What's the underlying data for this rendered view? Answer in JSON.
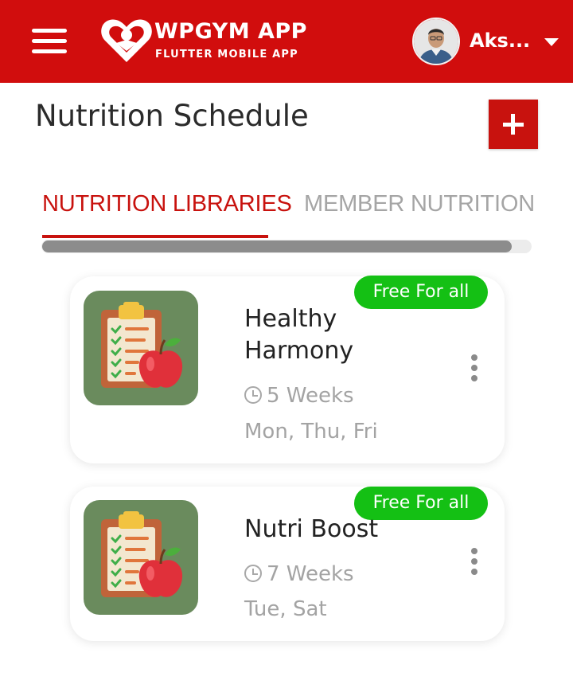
{
  "header": {
    "brand_title": "WPGYM APP",
    "brand_subtitle": "FLUTTER MOBILE APP",
    "user_name": "Aks...",
    "icons": {
      "menu": "hamburger-menu-icon",
      "logo": "heart-logo-icon",
      "dropdown": "caret-down-icon"
    },
    "colors": {
      "background": "#d10d0d",
      "text": "#ffffff"
    }
  },
  "page": {
    "title": "Nutrition Schedule",
    "add_icon": "plus-icon",
    "accent": "#c8120e"
  },
  "tabs": [
    {
      "label": "NUTRITION LIBRARIES",
      "active": true
    },
    {
      "label": "MEMBER NUTRITION",
      "active": false
    }
  ],
  "cards": [
    {
      "title": "Healthy Harmony",
      "badge": "Free For all",
      "duration": "5 Weeks",
      "days": "Mon, Thu, Fri",
      "icon": "clipboard-apple-icon"
    },
    {
      "title": "Nutri Boost",
      "badge": "Free For all",
      "duration": "7 Weeks",
      "days": "Tue, Sat",
      "icon": "clipboard-apple-icon"
    }
  ],
  "colors": {
    "badge": "#14c014",
    "thumb_bg": "#6a8b5d",
    "muted_text": "#a3a3a3"
  }
}
